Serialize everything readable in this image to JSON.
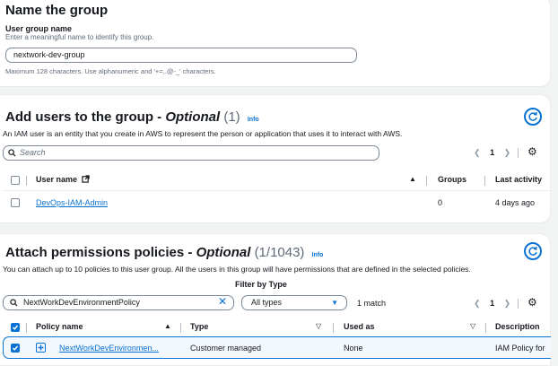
{
  "name_section": {
    "title": "Name the group",
    "field_label": "User group name",
    "field_hint": "Enter a meaningful name to identify this group.",
    "field_value": "nextwork-dev-group",
    "constraint": "Maximum 128 characters. Use alphanumeric and '+=,.@-_' characters."
  },
  "users_section": {
    "title_prefix": "Add users to the group - ",
    "title_optional": "Optional",
    "count": "(1)",
    "info": "Info",
    "description": "An IAM user is an entity that you create in AWS to represent the person or application that uses it to interact with AWS.",
    "search_placeholder": "Search",
    "page": "1",
    "columns": {
      "user_name": "User name",
      "groups": "Groups",
      "last_activity": "Last activity"
    },
    "rows": [
      {
        "user_name": "DevOps-IAM-Admin",
        "groups": "0",
        "last_activity": "4 days ago",
        "checked": false
      }
    ]
  },
  "policies_section": {
    "title_prefix": "Attach permissions policies - ",
    "title_optional": "Optional",
    "count": "(1/1043)",
    "info": "Info",
    "description": "You can attach up to 10 policies to this user group. All the users in this group will have permissions that are defined in the selected policies.",
    "filter_label": "Filter by Type",
    "search_value": "NextWorkDevEnvironmentPolicy",
    "type_filter_value": "All types",
    "match_count": "1 match",
    "page": "1",
    "columns": {
      "policy_name": "Policy name",
      "type": "Type",
      "used_as": "Used as",
      "description": "Description"
    },
    "rows": [
      {
        "policy_name": "NextWorkDevEnvironmen...",
        "type": "Customer managed",
        "used_as": "None",
        "description": "IAM Policy for",
        "checked": true
      }
    ]
  },
  "colors": {
    "accent": "#0972d3",
    "selected_row_bg": "#f2f8fd",
    "page_bg": "#f2f3f3"
  }
}
